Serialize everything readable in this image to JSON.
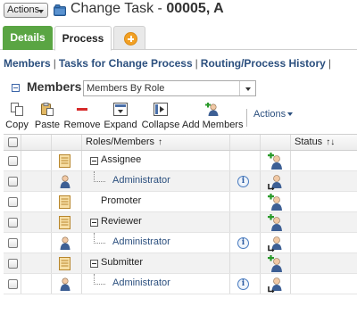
{
  "header": {
    "actions_label": "Actions",
    "title_prefix": "Change Task -",
    "title_id": "00005, A"
  },
  "tabs": [
    {
      "label": "Details"
    },
    {
      "label": "Process"
    }
  ],
  "subnav": [
    {
      "label": "Members"
    },
    {
      "label": "Tasks for Change Process"
    },
    {
      "label": "Routing/Process History"
    }
  ],
  "members": {
    "title": "Members",
    "view_select": "Members By Role"
  },
  "toolbar": {
    "copy": "Copy",
    "paste": "Paste",
    "remove": "Remove",
    "expand": "Expand",
    "collapse": "Collapse",
    "add_members": "Add Members",
    "actions": "Actions"
  },
  "table": {
    "col_roles": "Roles/Members",
    "col_status": "Status",
    "rows": [
      {
        "type": "role",
        "label": "Assignee"
      },
      {
        "type": "member",
        "label": "Administrator"
      },
      {
        "type": "role-leaf",
        "label": "Promoter"
      },
      {
        "type": "role",
        "label": "Reviewer"
      },
      {
        "type": "member",
        "label": "Administrator"
      },
      {
        "type": "role",
        "label": "Submitter"
      },
      {
        "type": "member",
        "label": "Administrator"
      }
    ]
  },
  "icons": {
    "task": "folder-icon",
    "role": "role-card-icon",
    "user": "user-icon",
    "info": "info-icon",
    "add_participant": "add-participant-icon",
    "replace_participant": "replace-participant-icon"
  },
  "colors": {
    "details_tab": "#5aa543",
    "link_blue": "#2b4f7e",
    "add_tab_orange": "#f2a024"
  }
}
